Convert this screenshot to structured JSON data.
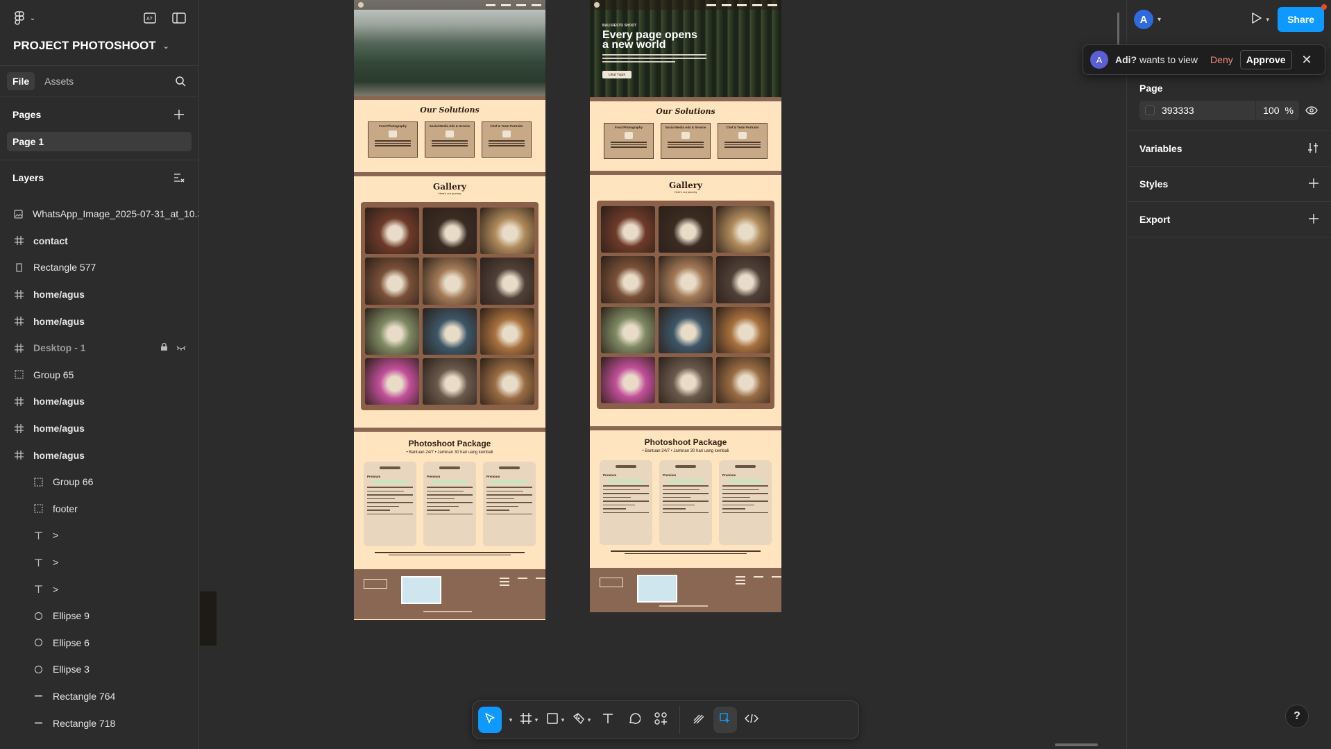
{
  "project": {
    "name": "PROJECT PHOTOSHOOT"
  },
  "left_panel": {
    "tabs": [
      "File",
      "Assets"
    ],
    "pages_header": "Pages",
    "current_page": "Page 1",
    "layers_header": "Layers",
    "layers": [
      {
        "name": "WhatsApp_Image_2025-07-31_at_10.3",
        "icon": "image-icon",
        "bold": false,
        "dim": false,
        "indent": false
      },
      {
        "name": "contact",
        "icon": "frame-icon",
        "bold": true,
        "dim": false,
        "indent": false
      },
      {
        "name": "Rectangle 577",
        "icon": "rectangle-icon",
        "bold": false,
        "dim": false,
        "indent": false
      },
      {
        "name": "home/agus",
        "icon": "frame-icon",
        "bold": true,
        "dim": false,
        "indent": false
      },
      {
        "name": "home/agus",
        "icon": "frame-icon",
        "bold": true,
        "dim": false,
        "indent": false
      },
      {
        "name": "Desktop - 1",
        "icon": "frame-icon",
        "bold": true,
        "dim": true,
        "indent": false,
        "locked": true,
        "hidden": true
      },
      {
        "name": "Group 65",
        "icon": "group-icon",
        "bold": false,
        "dim": false,
        "indent": false
      },
      {
        "name": "home/agus",
        "icon": "frame-icon",
        "bold": true,
        "dim": false,
        "indent": false
      },
      {
        "name": "home/agus",
        "icon": "frame-icon",
        "bold": true,
        "dim": false,
        "indent": false
      },
      {
        "name": "home/agus",
        "icon": "frame-icon",
        "bold": true,
        "dim": false,
        "indent": false
      },
      {
        "name": "Group 66",
        "icon": "group-icon",
        "bold": false,
        "dim": false,
        "indent": true
      },
      {
        "name": "footer",
        "icon": "group-icon",
        "bold": false,
        "dim": false,
        "indent": true
      },
      {
        "name": ">",
        "icon": "text-icon",
        "bold": false,
        "dim": false,
        "indent": true
      },
      {
        "name": ">",
        "icon": "text-icon",
        "bold": false,
        "dim": false,
        "indent": true
      },
      {
        "name": ">",
        "icon": "text-icon",
        "bold": false,
        "dim": false,
        "indent": true
      },
      {
        "name": "Ellipse 9",
        "icon": "ellipse-icon",
        "bold": false,
        "dim": false,
        "indent": true
      },
      {
        "name": "Ellipse 6",
        "icon": "ellipse-icon",
        "bold": false,
        "dim": false,
        "indent": true
      },
      {
        "name": "Ellipse 3",
        "icon": "ellipse-icon",
        "bold": false,
        "dim": false,
        "indent": true
      },
      {
        "name": "Rectangle 764",
        "icon": "line-icon",
        "bold": false,
        "dim": false,
        "indent": true
      },
      {
        "name": "Rectangle 718",
        "icon": "line-icon",
        "bold": false,
        "dim": false,
        "indent": true
      }
    ]
  },
  "canvas_frames": {
    "frame1": {
      "solutions_title": "Our Solutions",
      "cards": [
        "Food Photography",
        "Social Media Ads & Service",
        "Chef & Team Portraits"
      ],
      "gallery_title": "Gallery",
      "gallery_sub": "Here's our journey",
      "package_title": "Photoshoot Package",
      "package_sub": "• Bantuan 24/7  • Jaminan 30 hari uang kembali"
    },
    "frame2": {
      "hero_small": "BALI RESTO SHOOT",
      "hero_title": "Every page opens a new world",
      "hero_button": "Lihat Tujuh",
      "solutions_title": "Our Solutions",
      "cards": [
        "Food Photography",
        "Social Media Ads & Service",
        "Chef & Team Portraits"
      ],
      "gallery_title": "Gallery",
      "gallery_sub": "Here's our journey",
      "package_title": "Photoshoot Package",
      "package_sub": "• Bantuan 24/7  • Jaminan 30 hari uang kembali"
    },
    "package_cards": [
      "Premium",
      "Premium",
      "Premium"
    ],
    "gallery_colors": [
      "#6e3a2a",
      "#3b2c22",
      "#b08a5c",
      "#7a5038",
      "#a47a58",
      "#504038",
      "#7f8a64",
      "#3d5668",
      "#a8703e",
      "#c24f9a",
      "#6a5a4c",
      "#9a6c44"
    ]
  },
  "toolbar": {
    "tools": [
      "move-tool",
      "frame-tool",
      "rectangle-tool",
      "pen-tool",
      "text-tool",
      "comment-tool",
      "components-tool",
      "draw-mode",
      "design-mode",
      "dev-mode"
    ]
  },
  "right_panel": {
    "user_initial": "A",
    "share_label": "Share",
    "request": {
      "initial": "A",
      "user": "Adi?",
      "text": " wants to view",
      "deny": "Deny",
      "approve": "Approve"
    },
    "page_header": "Page",
    "page_fill_hex": "393333",
    "page_fill_opacity": "100",
    "percent_sign": "%",
    "variables_header": "Variables",
    "styles_header": "Styles",
    "export_header": "Export",
    "help": "?"
  },
  "colors": {
    "accent": "#0d99ff",
    "frame_bg": "#ffe4c0",
    "frame_brown": "#8a6752",
    "page_fill": "#393333"
  }
}
